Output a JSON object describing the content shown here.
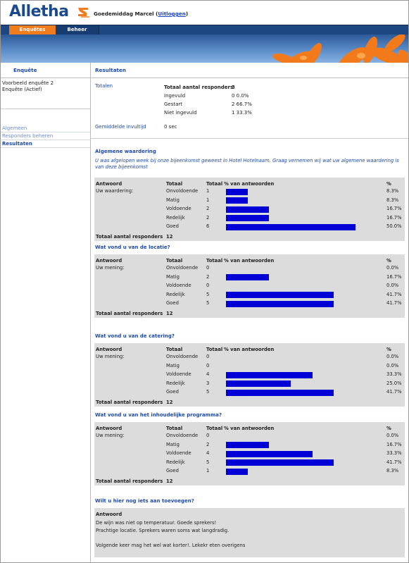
{
  "app": {
    "logo": "Alletha",
    "greeting": "Goedemiddag Marcel",
    "logout": "Uitloggen"
  },
  "nav": {
    "tabs": [
      {
        "label": "Enquêtes"
      },
      {
        "label": "Beheer"
      }
    ]
  },
  "sidebar": {
    "header": "Enquête",
    "survey_name": "Voorbeeld enquête 2",
    "survey_status": "Enquête (Actief)",
    "links": [
      {
        "label": "Algemeen"
      },
      {
        "label": "Responders beheren"
      },
      {
        "label": "Resultaten"
      }
    ]
  },
  "main": {
    "header": "Resultaten",
    "totals": {
      "label": "Totalen",
      "total_label": "Totaal aantal responders",
      "total_value": "3",
      "rows": [
        {
          "label": "Ingevuld",
          "value": "0 0.0%"
        },
        {
          "label": "Gestart",
          "value": "2 66.7%"
        },
        {
          "label": "Niet ingevuld",
          "value": "1 33.3%"
        }
      ],
      "avg_label": "Gemiddelde invultijd",
      "avg_value": "0 sec"
    },
    "col_headers": {
      "answer": "Antwoord",
      "total": "Totaal",
      "total2": "Totaal",
      "pct_label": "% van antwoorden",
      "pct": "%"
    },
    "footer_label": "Totaal aantal responders",
    "questions": [
      {
        "title": "Algemene waardering",
        "desc": "U was afgelopen week bij onze bijeenkomst geweest in Hotel Hotelnaam. Graag vernemen wij wat uw algemene waardering is van deze bijeenkomst",
        "row_label": "Uw waardering:",
        "rows": [
          {
            "option": "Onvoldoende",
            "count": "1",
            "pct": "8.3%",
            "frac": 0.083
          },
          {
            "option": "Matig",
            "count": "1",
            "pct": "8.3%",
            "frac": 0.083
          },
          {
            "option": "Voldoende",
            "count": "2",
            "pct": "16.7%",
            "frac": 0.167
          },
          {
            "option": "Redelijk",
            "count": "2",
            "pct": "16.7%",
            "frac": 0.167
          },
          {
            "option": "Goed",
            "count": "6",
            "pct": "50.0%",
            "frac": 0.5
          }
        ],
        "total": "12"
      },
      {
        "title": "Wat vond u van de locatie?",
        "desc": "",
        "row_label": "Uw mening:",
        "rows": [
          {
            "option": "Onvoldoende",
            "count": "0",
            "pct": "0.0%",
            "frac": 0
          },
          {
            "option": "Matig",
            "count": "2",
            "pct": "16.7%",
            "frac": 0.167
          },
          {
            "option": "Voldoende",
            "count": "0",
            "pct": "0.0%",
            "frac": 0
          },
          {
            "option": "Redelijk",
            "count": "5",
            "pct": "41.7%",
            "frac": 0.417
          },
          {
            "option": "Goed",
            "count": "5",
            "pct": "41.7%",
            "frac": 0.417
          }
        ],
        "total": "12"
      },
      {
        "title": "Wat vond u van de catering?",
        "desc": "",
        "row_label": "Uw mening:",
        "rows": [
          {
            "option": "Onvoldoende",
            "count": "0",
            "pct": "0.0%",
            "frac": 0
          },
          {
            "option": "Matig",
            "count": "0",
            "pct": "0.0%",
            "frac": 0
          },
          {
            "option": "Voldoende",
            "count": "4",
            "pct": "33.3%",
            "frac": 0.333
          },
          {
            "option": "Redelijk",
            "count": "3",
            "pct": "25.0%",
            "frac": 0.25
          },
          {
            "option": "Goed",
            "count": "5",
            "pct": "41.7%",
            "frac": 0.417
          }
        ],
        "total": "12"
      },
      {
        "title": "Wat vond u van het inhoudelijke programma?",
        "desc": "",
        "row_label": "Uw mening:",
        "rows": [
          {
            "option": "Onvoldoende",
            "count": "0",
            "pct": "0.0%",
            "frac": 0
          },
          {
            "option": "Matig",
            "count": "2",
            "pct": "16.7%",
            "frac": 0.167
          },
          {
            "option": "Voldoende",
            "count": "4",
            "pct": "33.3%",
            "frac": 0.333
          },
          {
            "option": "Redelijk",
            "count": "5",
            "pct": "41.7%",
            "frac": 0.417
          },
          {
            "option": "Goed",
            "count": "1",
            "pct": "8.3%",
            "frac": 0.083
          }
        ],
        "total": "12"
      }
    ],
    "open_question": {
      "title": "Wilt u hier nog iets aan toevoegen?",
      "header": "Antwoord",
      "answers": [
        "De wijn was niet op temperatuur. Goede sprekers!",
        "Prachtige locatie. Sprekers waren soms wat langdradig.",
        "",
        "Volgende keer mag het wel wat korter!. Lekekr eten overigens"
      ]
    }
  },
  "colors": {
    "brand_blue": "#1a4a8e",
    "nav_blue": "#1d4780",
    "accent_orange": "#f07c1e",
    "bar_blue": "#0000d6",
    "block_grey": "#dcdcdc"
  }
}
